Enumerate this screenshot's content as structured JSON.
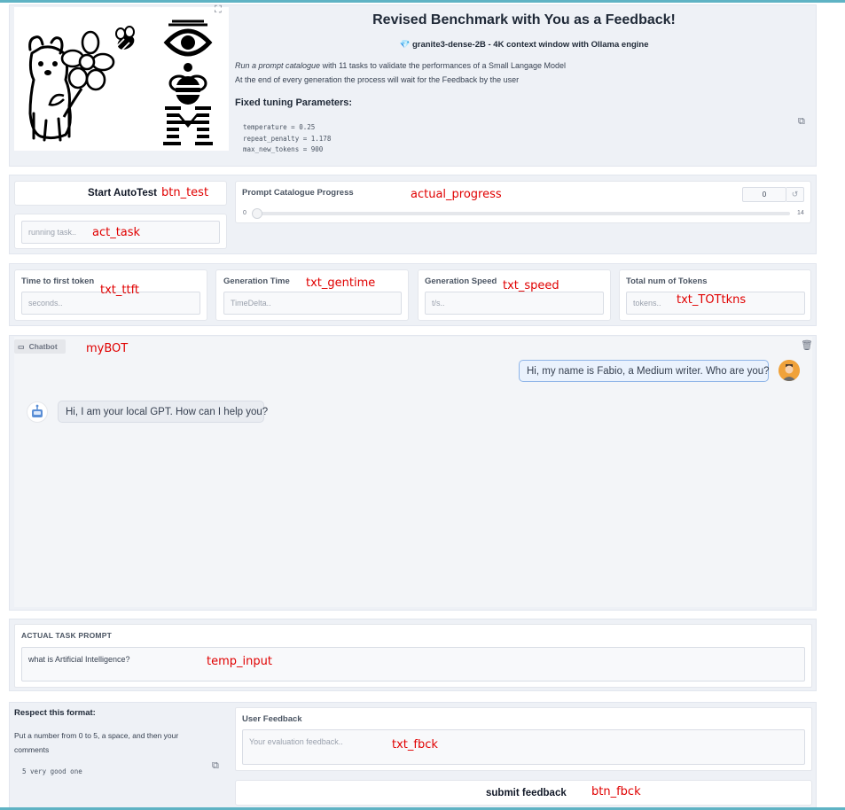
{
  "header": {
    "title": "Revised Benchmark with You as a Feedback!",
    "model_line": "granite3-dense-2B - 4K context window with Ollama engine",
    "description_line1_italic": "Run a prompt catalogue",
    "description_line1_rest": " with 11 tasks to validate the performances of a Small Langage Model",
    "description_line2": "At the end of every generation the process will wait for the Feedback by the user",
    "params_heading": "Fixed tuning Parameters:",
    "params": [
      "temperature = 0.25",
      "repeat_penalty = 1.178",
      "max_new_tokens = 900"
    ]
  },
  "controls": {
    "start_button": "Start AutoTest",
    "task_placeholder": "running task..",
    "progress_label": "Prompt Catalogue Progress",
    "progress_value": "0",
    "progress_min": "0",
    "progress_max": "14",
    "progress_fraction": 0
  },
  "metrics": [
    {
      "label": "Time to first token",
      "placeholder": "seconds.."
    },
    {
      "label": "Generation Time",
      "placeholder": "TimeDelta.."
    },
    {
      "label": "Generation Speed",
      "placeholder": "t/s.."
    },
    {
      "label": "Total num of Tokens",
      "placeholder": "tokens.."
    }
  ],
  "chatbot": {
    "label": "Chatbot",
    "messages": [
      {
        "role": "user",
        "text": "Hi, my name is Fabio, a Medium writer. Who are you?"
      },
      {
        "role": "bot",
        "text": "Hi, I am your local GPT. How can I help you?"
      }
    ]
  },
  "task_prompt": {
    "label": "ACTUAL TASK PROMPT",
    "value": "what is Artificial Intelligence?"
  },
  "feedback": {
    "format_heading": "Respect this format:",
    "format_text": "Put a number from 0 to 5, a space, and then your comments",
    "example": "5 very good one",
    "label": "User Feedback",
    "placeholder": "Your evaluation feedback..",
    "submit_button": "submit feedback"
  },
  "annotations": {
    "btn_test": "btn_test",
    "actual_progress": "actual_progress",
    "act_task": "act_task",
    "txt_ttft": "txt_ttft",
    "txt_gentime": "txt_gentime",
    "txt_speed": "txt_speed",
    "txt_TOTtkns": "txt_TOTtkns",
    "myBOT": "myBOT",
    "temp_input": "temp_input",
    "txt_fbck": "txt_fbck",
    "btn_fbck": "btn_fbck"
  },
  "colors": {
    "accent_bar": "#5fb3c4",
    "annotation": "#e00000",
    "user_bubble_border": "#8fb5e8",
    "panel": "#eef1f6"
  },
  "icons": [
    "fullscreen-icon",
    "copy-icon",
    "reset-icon",
    "chat-icon",
    "trash-icon",
    "gem-icon",
    "user-avatar",
    "bot-avatar"
  ]
}
